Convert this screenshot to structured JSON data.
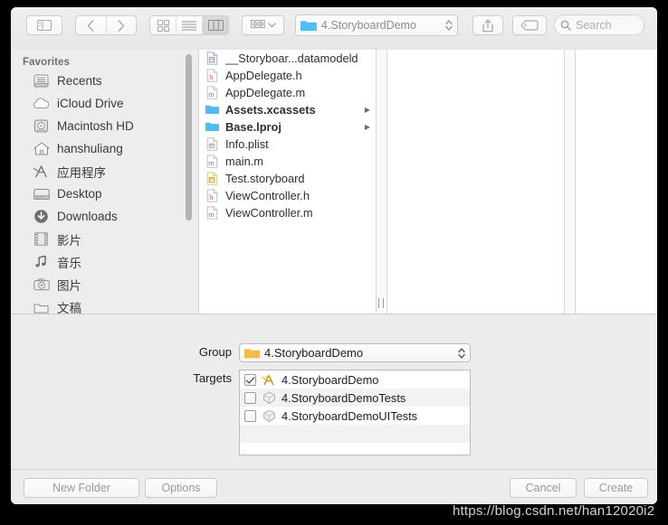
{
  "toolbar": {
    "sidebar_toggle": "sidebar-toggle",
    "back": "back",
    "forward": "forward",
    "view_icon": "icon-view",
    "view_list": "list-view",
    "view_column": "column-view",
    "arrange": "arrange",
    "path_label": "4.StoryboardDemo",
    "share": "share",
    "tag": "tag",
    "search_placeholder": "Search"
  },
  "sidebar": {
    "header": "Favorites",
    "items": [
      {
        "label": "Recents",
        "icon": "clock-recents-icon"
      },
      {
        "label": "iCloud Drive",
        "icon": "cloud-icon"
      },
      {
        "label": "Macintosh HD",
        "icon": "harddisk-icon"
      },
      {
        "label": "hanshuliang",
        "icon": "home-icon"
      },
      {
        "label": "应用程序",
        "icon": "applications-icon"
      },
      {
        "label": "Desktop",
        "icon": "desktop-icon"
      },
      {
        "label": "Downloads",
        "icon": "downloads-icon"
      },
      {
        "label": "影片",
        "icon": "movies-icon"
      },
      {
        "label": "音乐",
        "icon": "music-icon"
      },
      {
        "label": "图片",
        "icon": "pictures-icon"
      },
      {
        "label": "文稿",
        "icon": "documents-icon"
      }
    ]
  },
  "files": [
    {
      "name": "__Storyboar...datamodeld",
      "icon": "datamodel-file-icon",
      "kind": "file",
      "expandable": false
    },
    {
      "name": "AppDelegate.h",
      "icon": "h-file-icon",
      "kind": "file",
      "expandable": false
    },
    {
      "name": "AppDelegate.m",
      "icon": "m-file-icon",
      "kind": "file",
      "expandable": false
    },
    {
      "name": "Assets.xcassets",
      "icon": "folder-icon",
      "kind": "folder",
      "expandable": true
    },
    {
      "name": "Base.lproj",
      "icon": "folder-icon",
      "kind": "folder",
      "expandable": true
    },
    {
      "name": "Info.plist",
      "icon": "plist-file-icon",
      "kind": "file",
      "expandable": false
    },
    {
      "name": "main.m",
      "icon": "m-file-icon",
      "kind": "file",
      "expandable": false
    },
    {
      "name": "Test.storyboard",
      "icon": "storyboard-file-icon",
      "kind": "file",
      "expandable": false
    },
    {
      "name": "ViewController.h",
      "icon": "h-file-icon",
      "kind": "file",
      "expandable": false
    },
    {
      "name": "ViewController.m",
      "icon": "m-file-icon",
      "kind": "file",
      "expandable": false
    }
  ],
  "accessory": {
    "group_label": "Group",
    "group_value": "4.StoryboardDemo",
    "targets_label": "Targets",
    "targets": [
      {
        "name": "4.StoryboardDemo",
        "checked": true,
        "icon": "xcode-app-target-icon"
      },
      {
        "name": "4.StoryboardDemoTests",
        "checked": false,
        "icon": "test-target-icon"
      },
      {
        "name": "4.StoryboardDemoUITests",
        "checked": false,
        "icon": "test-target-icon"
      }
    ]
  },
  "buttons": {
    "new_folder": "New Folder",
    "options": "Options",
    "cancel": "Cancel",
    "create": "Create"
  },
  "watermark": "https://blog.csdn.net/han12020i2",
  "colors": {
    "folder_blue": "#4FBDF0",
    "folder_yellow": "#F2BC4B",
    "accent_h": "#C9536B",
    "accent_m": "#8B6FC4",
    "dialog_bg": "#ececec",
    "sidebar_bg": "#ededed"
  }
}
